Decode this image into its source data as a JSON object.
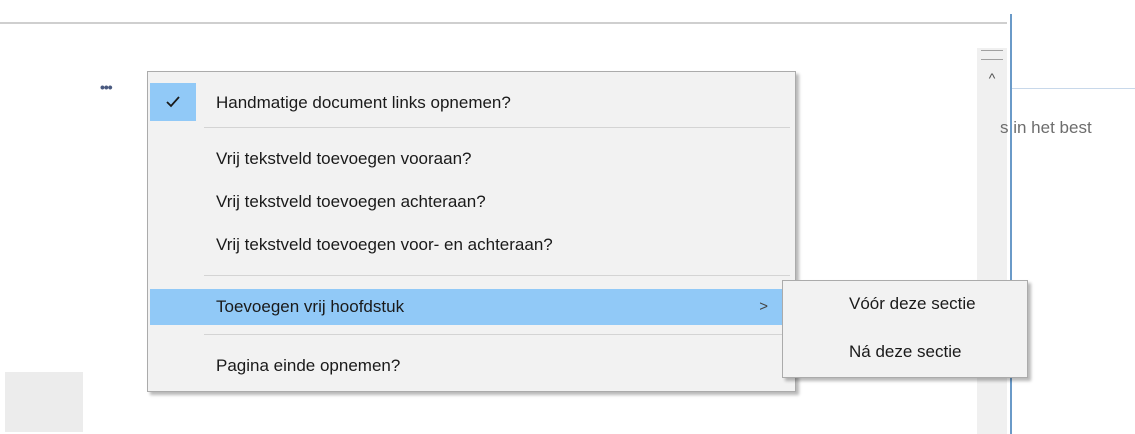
{
  "background": {
    "more_dots": "•••",
    "right_panel_text": "s in het best"
  },
  "scrollbar": {
    "up_arrow_glyph": "^"
  },
  "context_menu": {
    "items": [
      {
        "label": "Handmatige document links opnemen?",
        "checked": true
      },
      {
        "label": "Vrij tekstveld toevoegen vooraan?"
      },
      {
        "label": "Vrij tekstveld toevoegen achteraan?"
      },
      {
        "label": "Vrij tekstveld toevoegen voor- en achteraan?"
      },
      {
        "label": "Toevoegen vrij hoofdstuk",
        "submenu_arrow": ">",
        "highlighted": true
      },
      {
        "label": "Pagina einde opnemen?"
      }
    ]
  },
  "submenu": {
    "items": [
      {
        "label": "Vóór deze sectie"
      },
      {
        "label": "Ná deze sectie"
      }
    ]
  },
  "colors": {
    "highlight": "#91c9f7",
    "menu_background": "#f2f2f2",
    "menu_border": "#ababab",
    "panel_separator": "#6a9ac8"
  }
}
